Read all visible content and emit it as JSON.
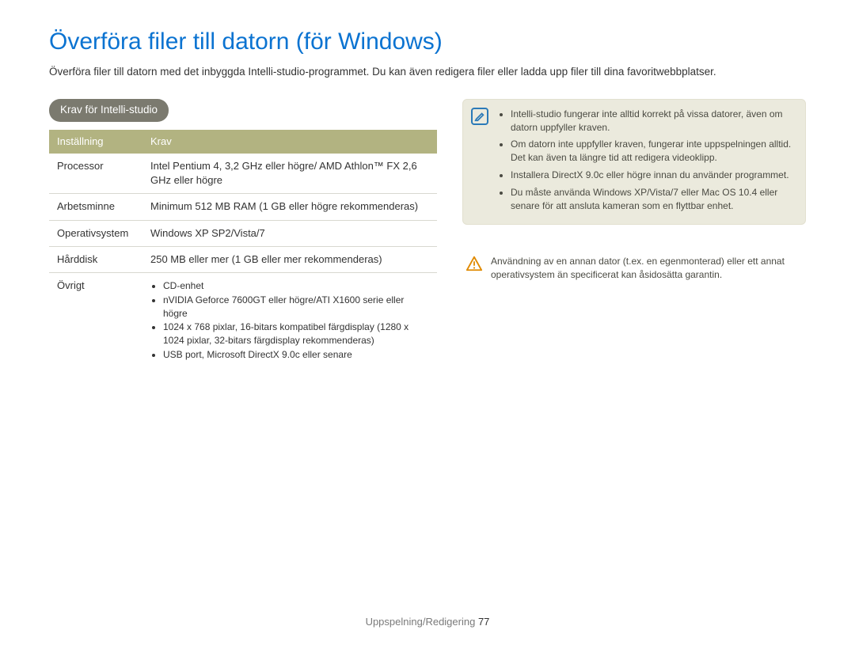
{
  "title": "Överföra filer till datorn (för Windows)",
  "intro": "Överföra filer till datorn med det inbyggda Intelli-studio-programmet. Du kan även redigera filer eller ladda upp filer till dina favoritwebbplatser.",
  "section_label": "Krav för Intelli-studio",
  "table": {
    "headers": {
      "setting": "Inställning",
      "req": "Krav"
    },
    "rows": {
      "processor": {
        "label": "Processor",
        "value": "Intel Pentium 4, 3,2 GHz eller högre/\nAMD Athlon™ FX 2,6 GHz eller högre"
      },
      "ram": {
        "label": "Arbetsminne",
        "value": "Minimum 512 MB RAM (1 GB eller högre rekommenderas)"
      },
      "os": {
        "label": "Operativsystem",
        "value": "Windows XP SP2/Vista/7"
      },
      "hdd": {
        "label": "Hårddisk",
        "value": "250 MB eller mer (1 GB eller mer rekommenderas)"
      },
      "other": {
        "label": "Övrigt",
        "items": [
          "CD-enhet",
          "nVIDIA Geforce 7600GT eller högre/ATI X1600 serie eller högre",
          "1024 x 768 pixlar, 16-bitars kompatibel färgdisplay (1280 x 1024 pixlar, 32-bitars färgdisplay rekommenderas)",
          "USB port, Microsoft DirectX 9.0c eller senare"
        ]
      }
    }
  },
  "notes": [
    "Intelli-studio fungerar inte alltid korrekt på vissa datorer, även om datorn uppfyller kraven.",
    "Om datorn inte uppfyller kraven, fungerar inte uppspelningen alltid. Det kan även ta längre tid att redigera videoklipp.",
    "Installera DirectX 9.0c eller högre innan du använder programmet.",
    "Du måste använda Windows XP/Vista/7 eller Mac OS 10.4 eller senare för att ansluta kameran som en flyttbar enhet."
  ],
  "warning": "Användning av en annan dator (t.ex. en egenmonterad) eller ett annat operativsystem än specificerat kan åsidosätta garantin.",
  "footer": {
    "section": "Uppspelning/Redigering",
    "page": "77"
  }
}
